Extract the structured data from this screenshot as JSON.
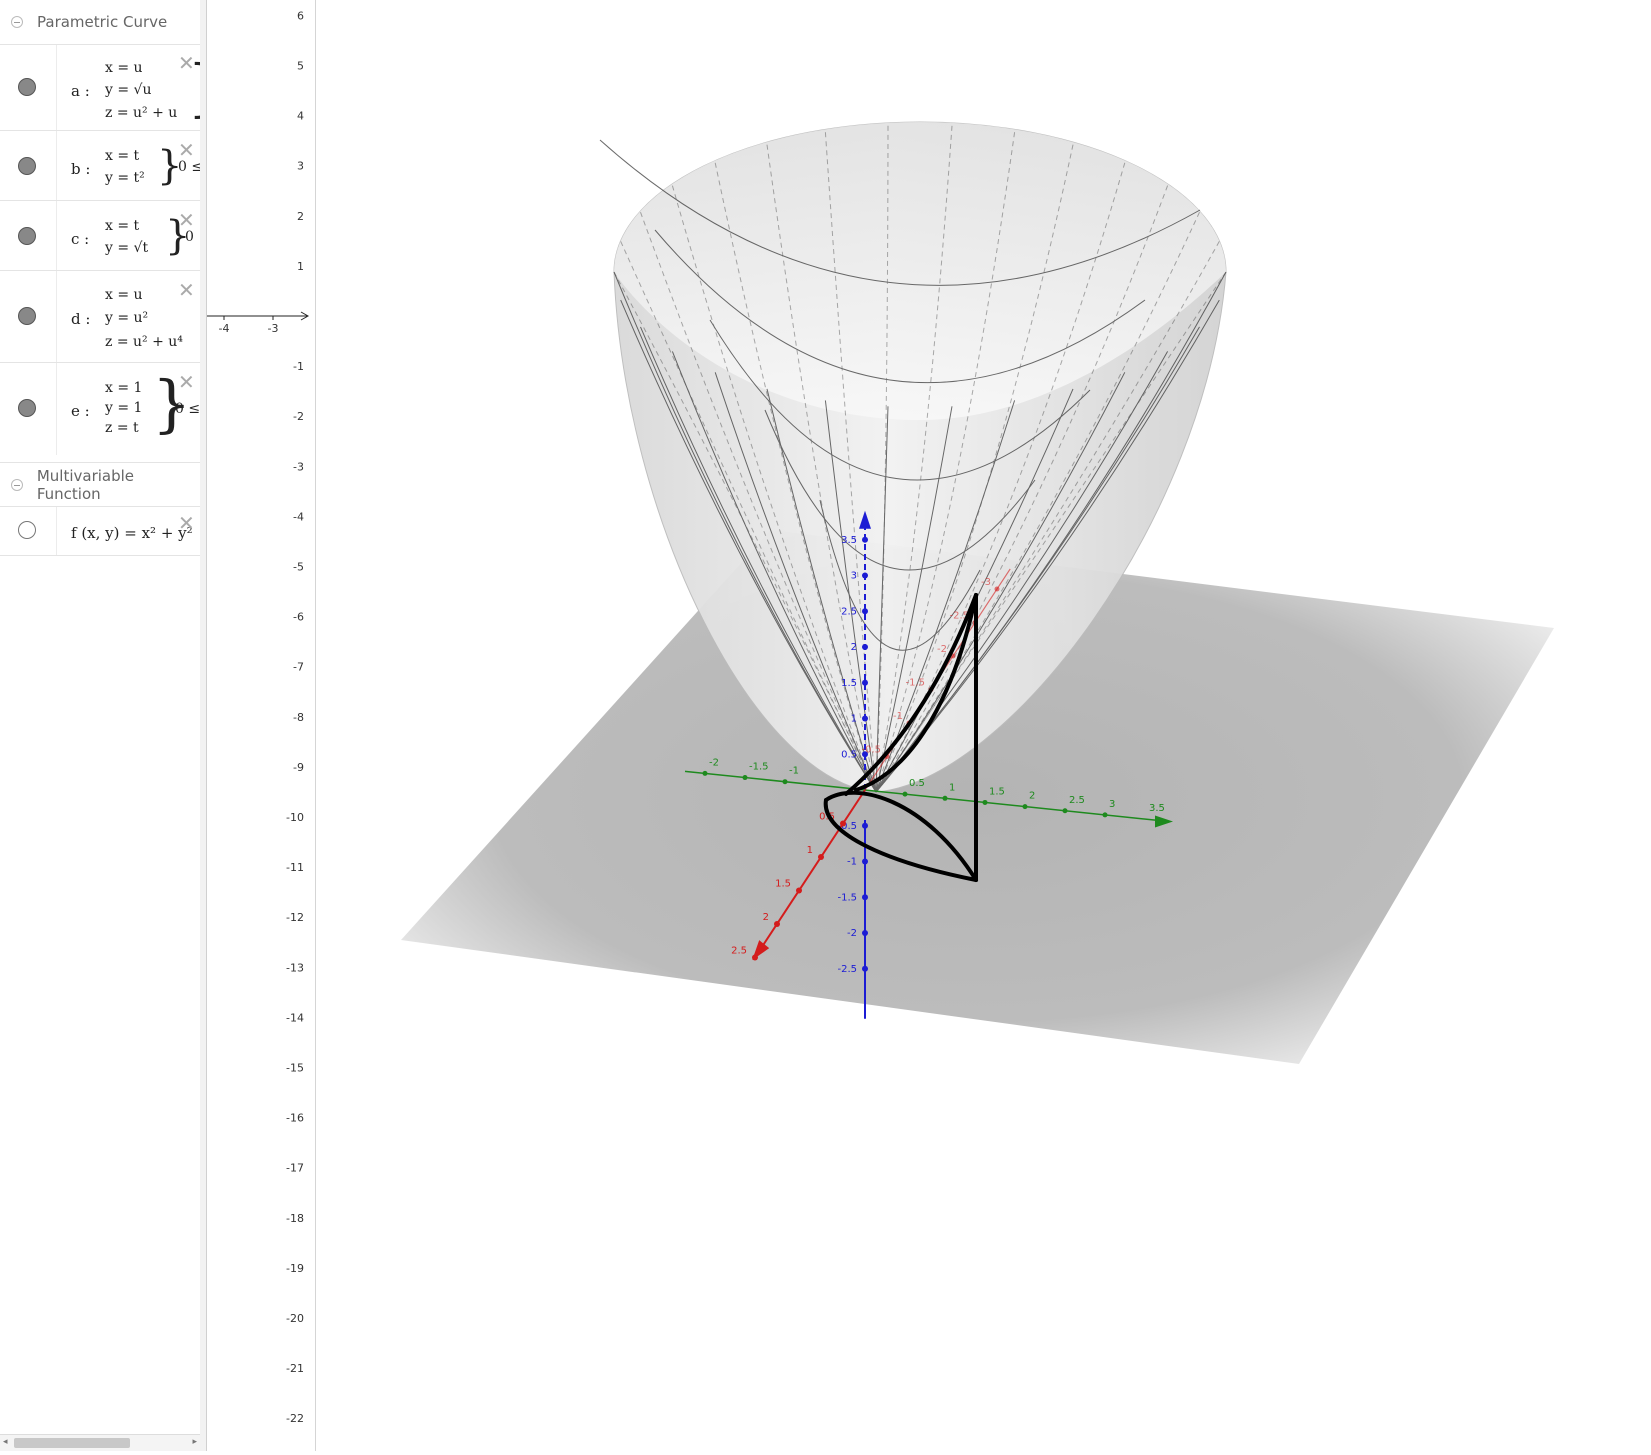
{
  "algebra": {
    "groups": [
      {
        "title": "Parametric Curve"
      },
      {
        "title": "Multivariable Function"
      }
    ],
    "items": [
      {
        "label": "a :",
        "lines": [
          "x = u",
          "y = √u",
          "z = u² + u"
        ]
      },
      {
        "label": "b :",
        "lines": [
          "x = t",
          "y = t²"
        ],
        "cond": "0 ≤"
      },
      {
        "label": "c :",
        "lines": [
          "x = t",
          "y = √t"
        ],
        "cond": "0"
      },
      {
        "label": "d :",
        "lines": [
          "x = u",
          "y = u²",
          "z = u² + u⁴"
        ]
      },
      {
        "label": "e :",
        "lines": [
          "x = 1",
          "y = 1",
          "z = t"
        ],
        "cond": "0 ≤"
      },
      {
        "label": "f (x, y)  =  x² + y²"
      }
    ]
  },
  "graphics2d": {
    "y_ticks": [
      "6",
      "5",
      "4",
      "3",
      "2",
      "1",
      "-1",
      "-2",
      "-3",
      "-4",
      "-5",
      "-6",
      "-7",
      "-8",
      "-9",
      "-10",
      "-11",
      "-12",
      "-13",
      "-14",
      "-15",
      "-16",
      "-17",
      "-18",
      "-19",
      "-20",
      "-21",
      "-22"
    ],
    "x_ticks": [
      "-4",
      "-3"
    ]
  },
  "graphics3d": {
    "x_axis_labels": [
      "0.5",
      "1",
      "1.5",
      "2",
      "2.5"
    ],
    "y_axis_labels": [
      "-2",
      "-1.5",
      "-1",
      "0.5",
      "1",
      "1.5",
      "2",
      "2.5",
      "3",
      "3.5"
    ],
    "z_axis_labels": [
      "3.5",
      "3",
      "2.5",
      "2",
      "1.5",
      "1",
      "0.5",
      "-0.5",
      "-1",
      "-1.5",
      "-2",
      "-2.5"
    ],
    "neg_x_labels": [
      "-0.5",
      "-1",
      "-1.5",
      "-2",
      "-2.5",
      "-3"
    ],
    "colors": {
      "x_axis": "#d41c1c",
      "y_axis": "#1e8a1e",
      "z_axis": "#1c1cd4",
      "plane": "#b8b8b8",
      "surface": "#e6e6e6"
    }
  }
}
